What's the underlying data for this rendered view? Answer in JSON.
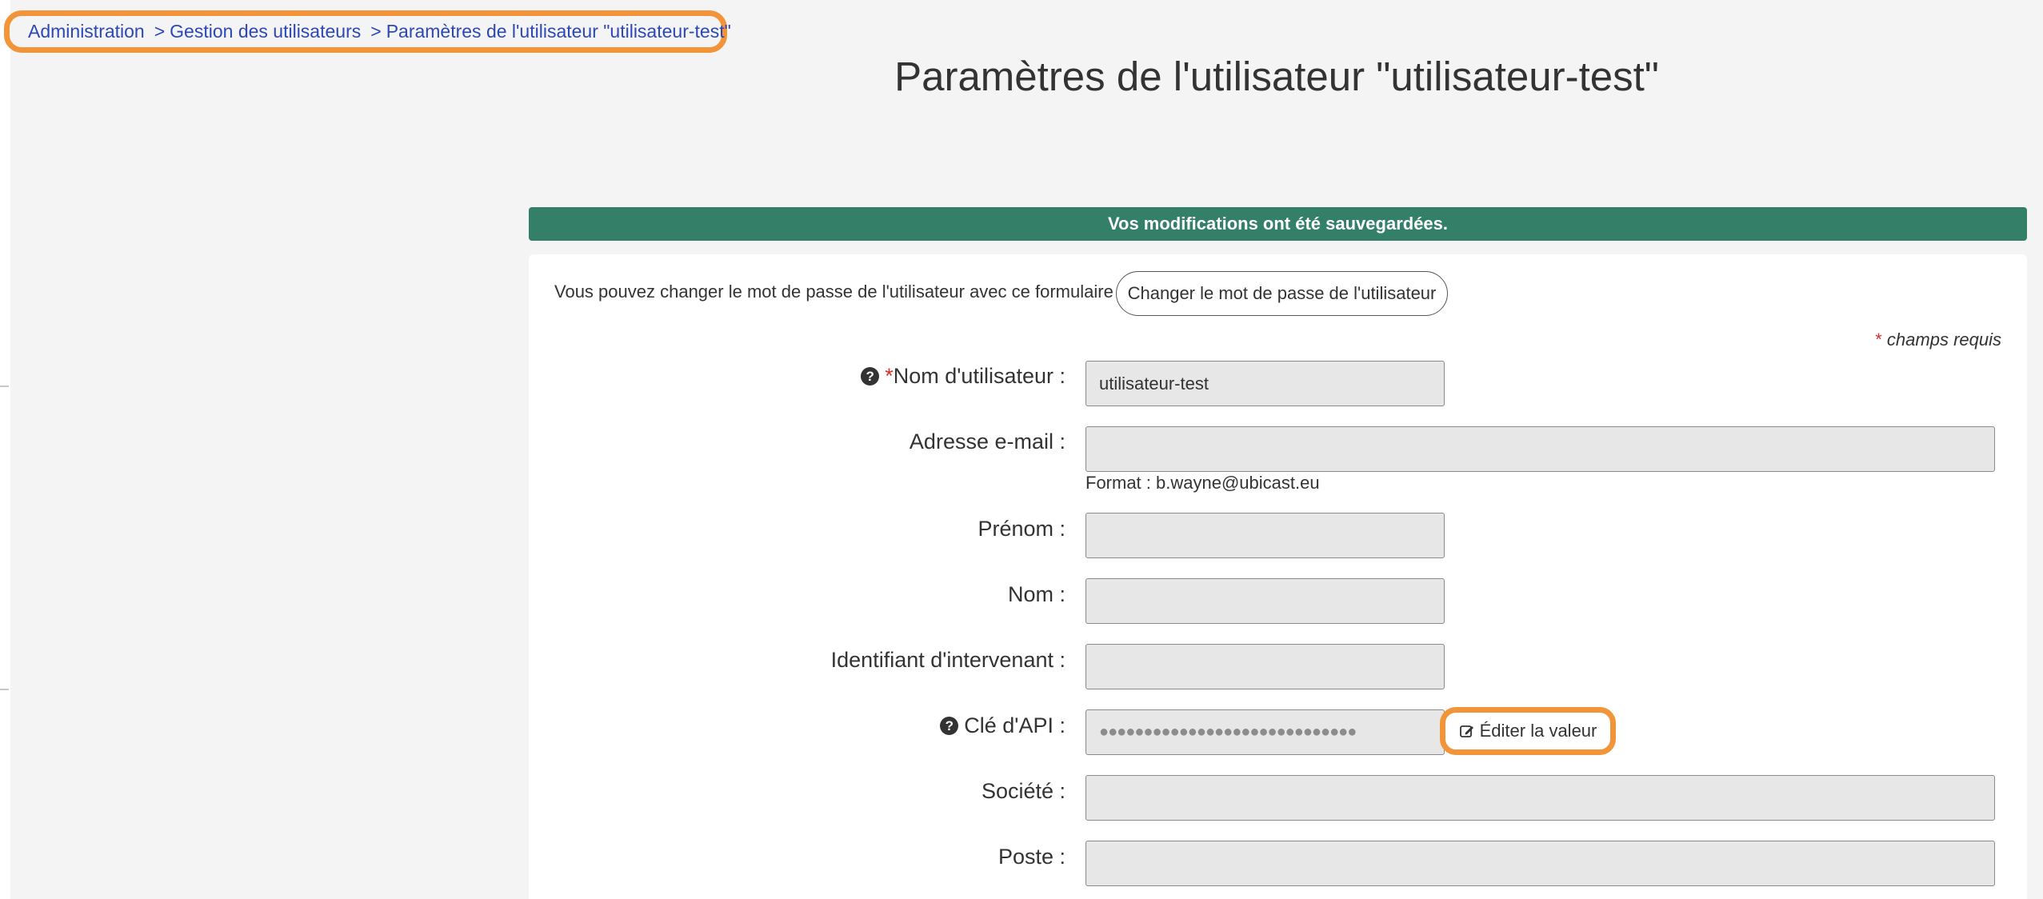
{
  "breadcrumb": {
    "items": [
      "Administration",
      "Gestion des utilisateurs",
      "Paramètres de l'utilisateur \"utilisateur-test\""
    ],
    "separator": ">"
  },
  "page": {
    "title": "Paramètres de l'utilisateur \"utilisateur-test\""
  },
  "alert": {
    "message": "Vos modifications ont été sauvegardées."
  },
  "password": {
    "text": "Vous pouvez changer le mot de passe de l'utilisateur avec ce formulaire :",
    "button_label": "Changer le mot de passe de l'utilisateur"
  },
  "required_note": {
    "star": "*",
    "text": "champs requis"
  },
  "form": {
    "username": {
      "label": "Nom d'utilisateur :",
      "required_star": "*",
      "value": "utilisateur-test",
      "help_icon": "question-circle-icon"
    },
    "email": {
      "label": "Adresse e-mail :",
      "value": "",
      "hint": "Format : b.wayne@ubicast.eu"
    },
    "first_name": {
      "label": "Prénom :",
      "value": ""
    },
    "last_name": {
      "label": "Nom :",
      "value": ""
    },
    "speaker_id": {
      "label": "Identifiant d'intervenant :",
      "value": ""
    },
    "api_key": {
      "label": "Clé d'API :",
      "masked_value": "●●●●●●●●●●●●●●●●●●●●●●●●●●●●●",
      "help_icon": "question-circle-icon",
      "edit_label": "Éditer la valeur",
      "edit_icon": "edit-icon"
    },
    "company": {
      "label": "Société :",
      "value": ""
    },
    "position": {
      "label": "Poste :",
      "value": ""
    }
  },
  "colors": {
    "accent_highlight": "#f2953a",
    "link": "#2c48b8",
    "success": "#337f67",
    "required": "#d9302c"
  }
}
